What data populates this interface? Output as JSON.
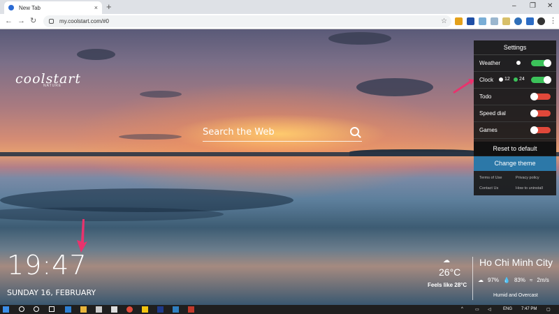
{
  "browser": {
    "tab_title": "New Tab",
    "tab_close": "×",
    "new_tab": "+",
    "url": "my.coolstart.com/#0",
    "win_minimize": "–",
    "win_restore": "❐",
    "win_close": "✕"
  },
  "brand": {
    "name": "coolstart",
    "tagline": "NATURE"
  },
  "search": {
    "placeholder": "Search the Web"
  },
  "clock": {
    "time": "19:47",
    "date": "SUNDAY 16, FEBRUARY"
  },
  "weather": {
    "temp": "26°C",
    "feels_like": "Feels like 28°C",
    "city": "Ho Chi Minh City",
    "cloud": "97%",
    "humidity": "83%",
    "wind": "2m/s",
    "description": "Humid and Overcast"
  },
  "settings": {
    "title": "Settings",
    "rows": [
      {
        "label": "Weather",
        "on": true
      },
      {
        "label": "Clock",
        "on": true,
        "opt1": "12",
        "opt2": "24"
      },
      {
        "label": "Todo",
        "on": false
      },
      {
        "label": "Speed dial",
        "on": false
      },
      {
        "label": "Games",
        "on": false
      }
    ],
    "reset_label": "Reset to default",
    "theme_label": "Change theme",
    "footer": {
      "terms": "Terms of Use",
      "privacy": "Privacy policy",
      "contact": "Contact Us",
      "uninstall": "How to uninstall"
    }
  },
  "taskbar": {
    "lang": "ENG",
    "time": "7:47 PM"
  },
  "colors": {
    "toggle_on": "#3cc25a",
    "toggle_off": "#e0483a",
    "theme_button": "#2c78a8",
    "arrow": "#e8336d"
  }
}
